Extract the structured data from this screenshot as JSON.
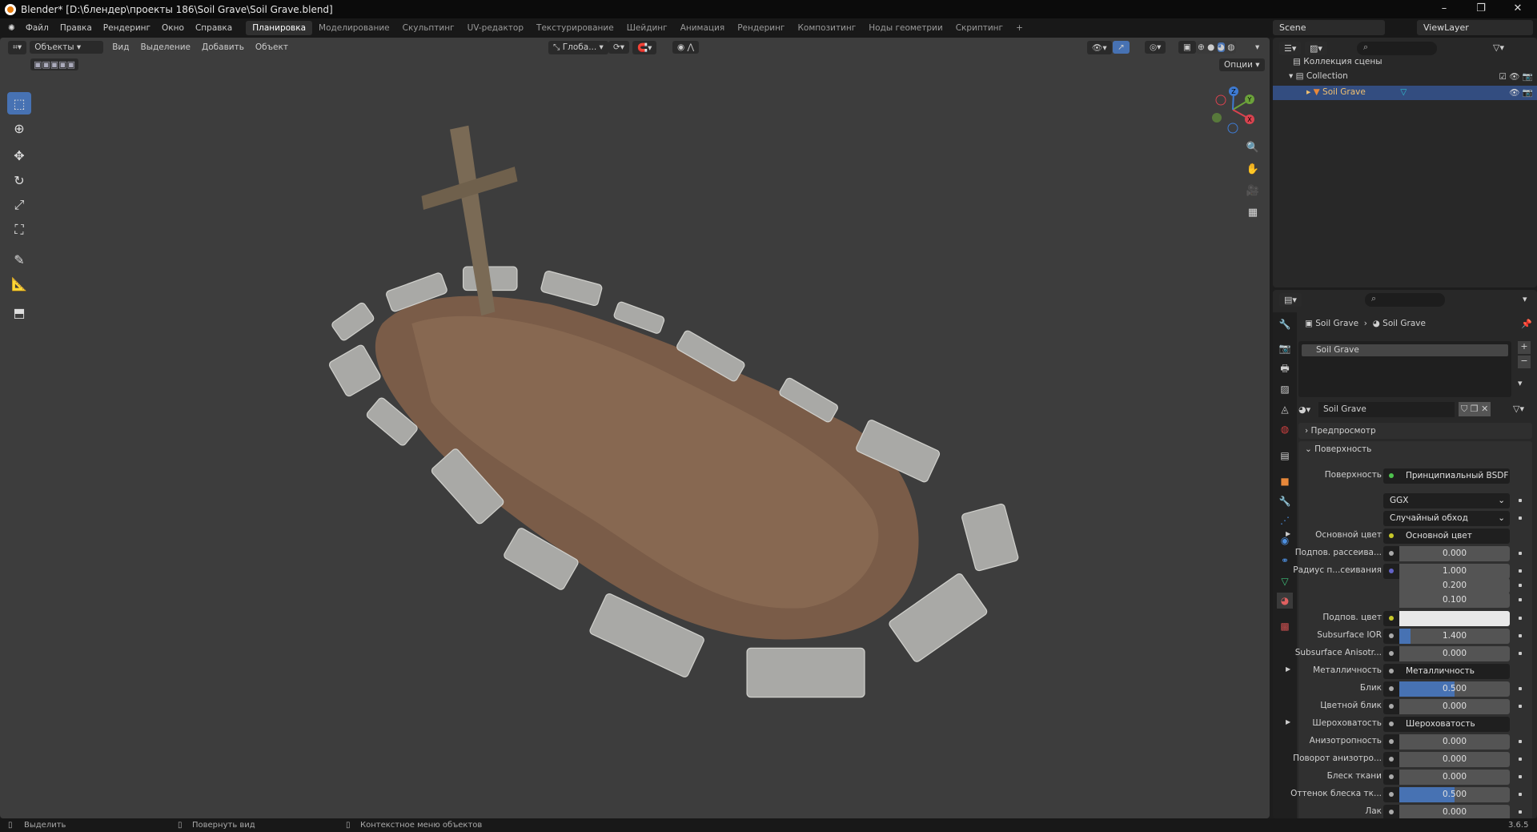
{
  "window": {
    "title": "Blender* [D:\\блендер\\проекты 186\\Soil Grave\\Soil Grave.blend]",
    "controls": [
      "–",
      "❐",
      "✕"
    ]
  },
  "menu": {
    "items": [
      "Файл",
      "Правка",
      "Рендеринг",
      "Окно",
      "Справка"
    ],
    "workspaces": [
      "Планировка",
      "Моделирование",
      "Скульптинг",
      "UV-редактор",
      "Текстурирование",
      "Шейдинг",
      "Анимация",
      "Рендеринг",
      "Композитинг",
      "Ноды геометрии",
      "Скриптинг"
    ],
    "active_workspace": 0,
    "add": "+"
  },
  "scene": {
    "name": "Scene",
    "view_layer": "ViewLayer"
  },
  "viewport": {
    "mode": "Объекты",
    "menus": [
      "Вид",
      "Выделение",
      "Добавить",
      "Объект"
    ],
    "transform_orientation": "Глоба...",
    "options": "Опции",
    "tools": [
      "select-box",
      "cursor",
      "move",
      "rotate",
      "scale",
      "transform",
      "annotate",
      "measure",
      "add-cube"
    ],
    "gizmo": {
      "x": "X",
      "y": "Y",
      "z": "Z"
    }
  },
  "outliner": {
    "root": "Коллекция сцены",
    "collection": "Collection",
    "object": "Soil Grave"
  },
  "properties": {
    "breadcrumb": [
      "Soil Grave",
      "Soil Grave"
    ],
    "material_slot": "Soil Grave",
    "material_name": "Soil Grave",
    "panels": {
      "preview": "Предпросмотр",
      "surface": "Поверхность"
    },
    "rows": [
      {
        "label": "Поверхность",
        "type": "link",
        "value": "Принципиальный BSDF",
        "socket": "#4ec24e"
      },
      {
        "label": "",
        "type": "select",
        "value": "GGX"
      },
      {
        "label": "",
        "type": "select",
        "value": "Случайный обход"
      },
      {
        "label": "Основной цвет",
        "type": "link",
        "value": "Основной цвет",
        "socket": "#c7c729",
        "expand": true
      },
      {
        "label": "Подпов. рассеива...",
        "type": "num",
        "value": "0.000",
        "fill": 0
      },
      {
        "label": "Радиус п...сеивания",
        "type": "num",
        "value": "1.000",
        "fill": 0,
        "socket": "#6363c7"
      },
      {
        "label": "",
        "type": "num",
        "value": "0.200",
        "fill": 0,
        "nosock": true
      },
      {
        "label": "",
        "type": "num",
        "value": "0.100",
        "fill": 0,
        "nosock": true
      },
      {
        "label": "Подпов. цвет",
        "type": "color",
        "value": "#e8e8e8",
        "socket": "#c7c729"
      },
      {
        "label": "Subsurface IOR",
        "type": "num",
        "value": "1.400",
        "fill": 0.1
      },
      {
        "label": "Subsurface Anisotr...",
        "type": "num",
        "value": "0.000",
        "fill": 0
      },
      {
        "label": "Металличность",
        "type": "link",
        "value": "Металличность",
        "expand": true
      },
      {
        "label": "Блик",
        "type": "num",
        "value": "0.500",
        "fill": 0.5
      },
      {
        "label": "Цветной блик",
        "type": "num",
        "value": "0.000",
        "fill": 0
      },
      {
        "label": "Шероховатость",
        "type": "link",
        "value": "Шероховатость",
        "expand": true
      },
      {
        "label": "Анизотропность",
        "type": "num",
        "value": "0.000",
        "fill": 0
      },
      {
        "label": "Поворот анизотро...",
        "type": "num",
        "value": "0.000",
        "fill": 0
      },
      {
        "label": "Блеск ткани",
        "type": "num",
        "value": "0.000",
        "fill": 0
      },
      {
        "label": "Оттенок блеска тк...",
        "type": "num",
        "value": "0.500",
        "fill": 0.5
      },
      {
        "label": "Лак",
        "type": "num",
        "value": "0.000",
        "fill": 0
      }
    ]
  },
  "statusbar": {
    "items": [
      "Выделить",
      "Повернуть вид",
      "Контекстное меню объектов"
    ],
    "version": "3.6.5"
  },
  "colors": {
    "accent": "#4772b3",
    "selection": "#334d80",
    "soil": "#7a5c48",
    "stone": "#a9a9a6"
  }
}
